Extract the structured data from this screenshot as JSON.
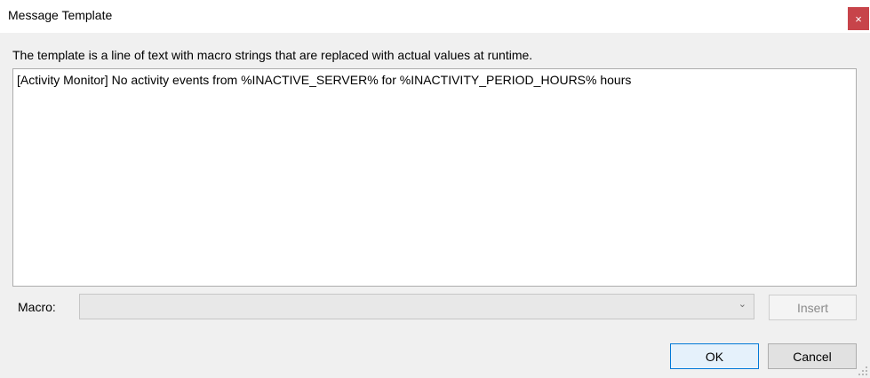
{
  "window": {
    "title": "Message Template",
    "close_glyph": "×",
    "close_color": "#c7444a"
  },
  "description": "The template is a line of text with macro strings that are replaced with actual values at runtime.",
  "template": {
    "value": "[Activity Monitor] No activity events from %INACTIVE_SERVER% for %INACTIVITY_PERIOD_HOURS% hours"
  },
  "macro": {
    "label": "Macro:",
    "selected": "",
    "chevron": "⌄",
    "insert_label": "Insert"
  },
  "buttons": {
    "ok_label": "OK",
    "cancel_label": "Cancel"
  },
  "colors": {
    "default_button_border": "#0078d7"
  },
  "icons": {
    "close": "close-icon",
    "dropdown": "chevron-down-icon",
    "resize": "resize-grip-icon"
  }
}
